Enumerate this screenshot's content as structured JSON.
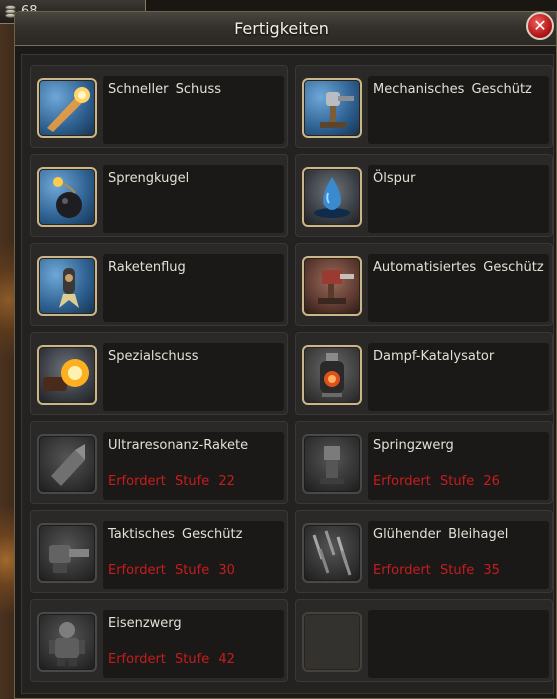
{
  "currency": {
    "value": "68",
    "icon": "coin-stack-icon"
  },
  "window": {
    "title": "Fertigkeiten",
    "close_icon": "close-icon"
  },
  "skills": [
    {
      "name": "Schneller Schuss",
      "requirement": "",
      "locked": false,
      "icon": "fire-bullet-icon"
    },
    {
      "name": "Mechanisches Geschütz",
      "requirement": "",
      "locked": false,
      "icon": "turret-icon"
    },
    {
      "name": "Sprengkugel",
      "requirement": "",
      "locked": false,
      "icon": "bomb-icon"
    },
    {
      "name": "Ölspur",
      "requirement": "",
      "locked": false,
      "icon": "oil-drop-icon"
    },
    {
      "name": "Raketenflug",
      "requirement": "",
      "locked": false,
      "icon": "rocket-flight-icon"
    },
    {
      "name": "Automatisiertes Geschütz",
      "requirement": "",
      "locked": false,
      "icon": "auto-turret-icon"
    },
    {
      "name": "Spezialschuss",
      "requirement": "",
      "locked": false,
      "icon": "special-shot-icon"
    },
    {
      "name": "Dampf-Katalysator",
      "requirement": "",
      "locked": false,
      "icon": "steam-catalyst-icon"
    },
    {
      "name": "Ultraresonanz-Rakete",
      "requirement": "Erfordert Stufe 22",
      "locked": true,
      "icon": "rocket-icon"
    },
    {
      "name": "Springzwerg",
      "requirement": "Erfordert Stufe 26",
      "locked": true,
      "icon": "jumping-dwarf-icon"
    },
    {
      "name": "Taktisches Geschütz",
      "requirement": "Erfordert Stufe 30",
      "locked": true,
      "icon": "tactical-cannon-icon"
    },
    {
      "name": "Glühender Bleihagel",
      "requirement": "Erfordert Stufe 35",
      "locked": true,
      "icon": "lead-hail-icon"
    },
    {
      "name": "Eisenzwerg",
      "requirement": "Erfordert Stufe 42",
      "locked": true,
      "icon": "iron-dwarf-icon"
    },
    {
      "name": "",
      "requirement": "",
      "locked": false,
      "empty": true,
      "icon": "empty-slot-icon"
    }
  ]
}
